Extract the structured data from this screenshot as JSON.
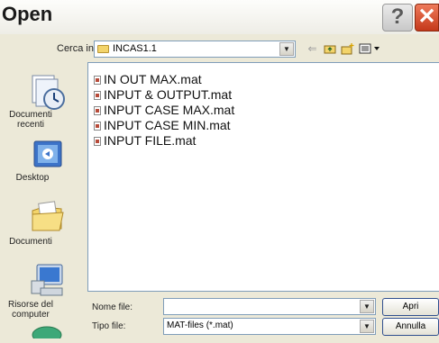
{
  "window": {
    "title": "Open",
    "help_glyph": "?",
    "close_glyph": "✕"
  },
  "toolbar": {
    "look_in_label": "Cerca in:",
    "look_in_value": "INCAS1.1",
    "icons": [
      "back-arrow-icon",
      "up-folder-icon",
      "new-folder-icon",
      "view-menu-icon"
    ]
  },
  "places": [
    {
      "label": "Documenti recenti",
      "icon": "recent-documents-icon"
    },
    {
      "label": "Desktop",
      "icon": "desktop-icon"
    },
    {
      "label": "Documenti",
      "icon": "documents-folder-icon"
    },
    {
      "label": "Risorse del computer",
      "icon": "my-computer-icon"
    },
    {
      "label": "",
      "icon": "network-icon"
    }
  ],
  "files": [
    {
      "name": "IN OUT MAX.mat"
    },
    {
      "name": "INPUT & OUTPUT.mat"
    },
    {
      "name": "INPUT CASE MAX.mat"
    },
    {
      "name": "INPUT CASE MIN.mat"
    },
    {
      "name": "INPUT FILE.mat"
    }
  ],
  "form": {
    "filename_label": "Nome file:",
    "filename_value": "",
    "filetype_label": "Tipo file:",
    "filetype_value": "MAT-files (*.mat)",
    "open_label": "Apri",
    "cancel_label": "Annulla"
  }
}
